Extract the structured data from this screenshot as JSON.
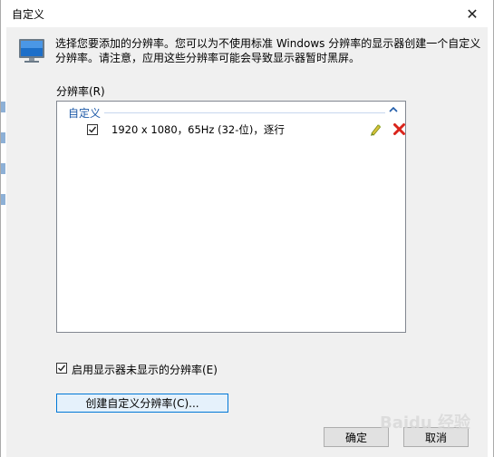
{
  "window": {
    "title": "自定义",
    "close_glyph": "✕"
  },
  "description": "选择您要添加的分辨率。您可以为不使用标准 Windows 分辨率的显示器创建一个自定义分辨率。请注意，应用这些分辨率可能会导致显示器暂时黑屏。",
  "resolutions": {
    "label": "分辨率(R)",
    "group_header": "自定义",
    "items": [
      {
        "text": "1920 x 1080，65Hz (32-位)，逐行",
        "checked": true
      }
    ]
  },
  "enable_option": {
    "label": "启用显示器未显示的分辨率(E)",
    "checked": true
  },
  "buttons": {
    "create": "创建自定义分辨率(C)...",
    "ok": "确定",
    "cancel": "取消"
  },
  "watermark": "Baidu 经验",
  "colors": {
    "accent": "#0078d7",
    "group_header": "#1e5aa8",
    "delete_red": "#d9241b"
  }
}
